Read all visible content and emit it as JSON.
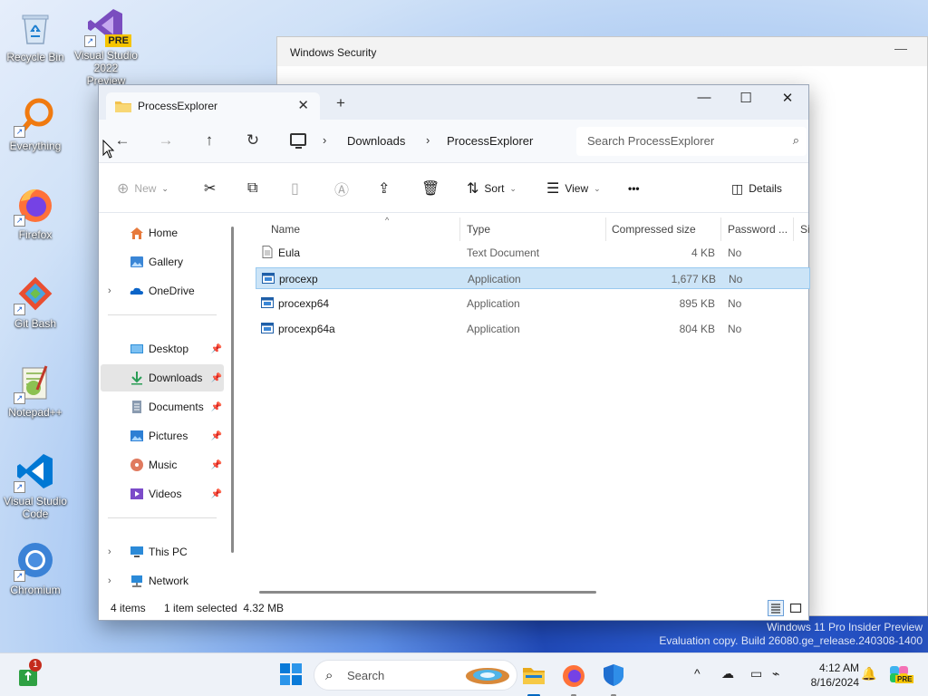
{
  "desktop": {
    "icons": [
      {
        "label": "Recycle Bin",
        "icon": "recycle-bin-icon"
      },
      {
        "label": "Visual Studio 2022 Preview",
        "badge": "PRE",
        "icon": "visual-studio-icon"
      },
      {
        "label": "Everything",
        "icon": "everything-search-icon"
      },
      {
        "label": "Firefox",
        "icon": "firefox-icon"
      },
      {
        "label": "Git Bash",
        "icon": "git-bash-icon"
      },
      {
        "label": "Notepad++",
        "icon": "notepad-plus-plus-icon"
      },
      {
        "label": "Visual Studio Code",
        "icon": "vscode-icon"
      },
      {
        "label": "Chromium",
        "icon": "chromium-icon"
      }
    ]
  },
  "security_window": {
    "title": "Windows Security",
    "minimize": "—"
  },
  "explorer": {
    "tab_title": "ProcessExplorer",
    "new_tab": "+",
    "close_tab": "✕",
    "window": {
      "minimize": "—",
      "maximize": "☐",
      "close": "✕"
    },
    "breadcrumb": [
      "Downloads",
      "ProcessExplorer"
    ],
    "search_placeholder": "Search ProcessExplorer",
    "toolbar": {
      "new": "New",
      "sort": "Sort",
      "view": "View",
      "more": "•••",
      "details": "Details"
    },
    "nav": {
      "items_top": [
        {
          "label": "Home",
          "icon": "home-icon"
        },
        {
          "label": "Gallery",
          "icon": "gallery-icon"
        },
        {
          "label": "OneDrive",
          "icon": "onedrive-icon",
          "expandable": true
        }
      ],
      "quick_access": [
        {
          "label": "Desktop",
          "icon": "desktop-folder-icon",
          "pinned": true
        },
        {
          "label": "Downloads",
          "icon": "downloads-folder-icon",
          "pinned": true,
          "selected": true
        },
        {
          "label": "Documents",
          "icon": "documents-folder-icon",
          "pinned": true
        },
        {
          "label": "Pictures",
          "icon": "pictures-folder-icon",
          "pinned": true
        },
        {
          "label": "Music",
          "icon": "music-folder-icon",
          "pinned": true
        },
        {
          "label": "Videos",
          "icon": "videos-folder-icon",
          "pinned": true
        }
      ],
      "items_bottom": [
        {
          "label": "This PC",
          "icon": "this-pc-icon",
          "expandable": true
        },
        {
          "label": "Network",
          "icon": "network-icon",
          "expandable": true
        }
      ]
    },
    "columns": [
      "Name",
      "Type",
      "Compressed size",
      "Password ...",
      "Si"
    ],
    "files": [
      {
        "name": "Eula",
        "type": "Text Document",
        "size": "4 KB",
        "password": "No",
        "icon": "text-document-icon",
        "selected": false
      },
      {
        "name": "procexp",
        "type": "Application",
        "size": "1,677 KB",
        "password": "No",
        "icon": "application-icon",
        "selected": true
      },
      {
        "name": "procexp64",
        "type": "Application",
        "size": "895 KB",
        "password": "No",
        "icon": "application-icon",
        "selected": false
      },
      {
        "name": "procexp64a",
        "type": "Application",
        "size": "804 KB",
        "password": "No",
        "icon": "application-icon",
        "selected": false
      }
    ],
    "status": {
      "item_count": "4 items",
      "selection": "1 item selected  4.32 MB"
    }
  },
  "watermark": {
    "line1": "Windows 11 Pro Insider Preview",
    "line2": "Evaluation copy. Build 26080.ge_release.240308-1400"
  },
  "taskbar": {
    "notification_count": "1",
    "search_placeholder": "Search",
    "clock_time": "4:12 AM",
    "clock_date": "8/16/2024",
    "tray_chevron": "^"
  },
  "colors": {
    "accent": "#0067c0",
    "selection_bg": "#cce4f7",
    "selection_border": "#99c9ef"
  }
}
